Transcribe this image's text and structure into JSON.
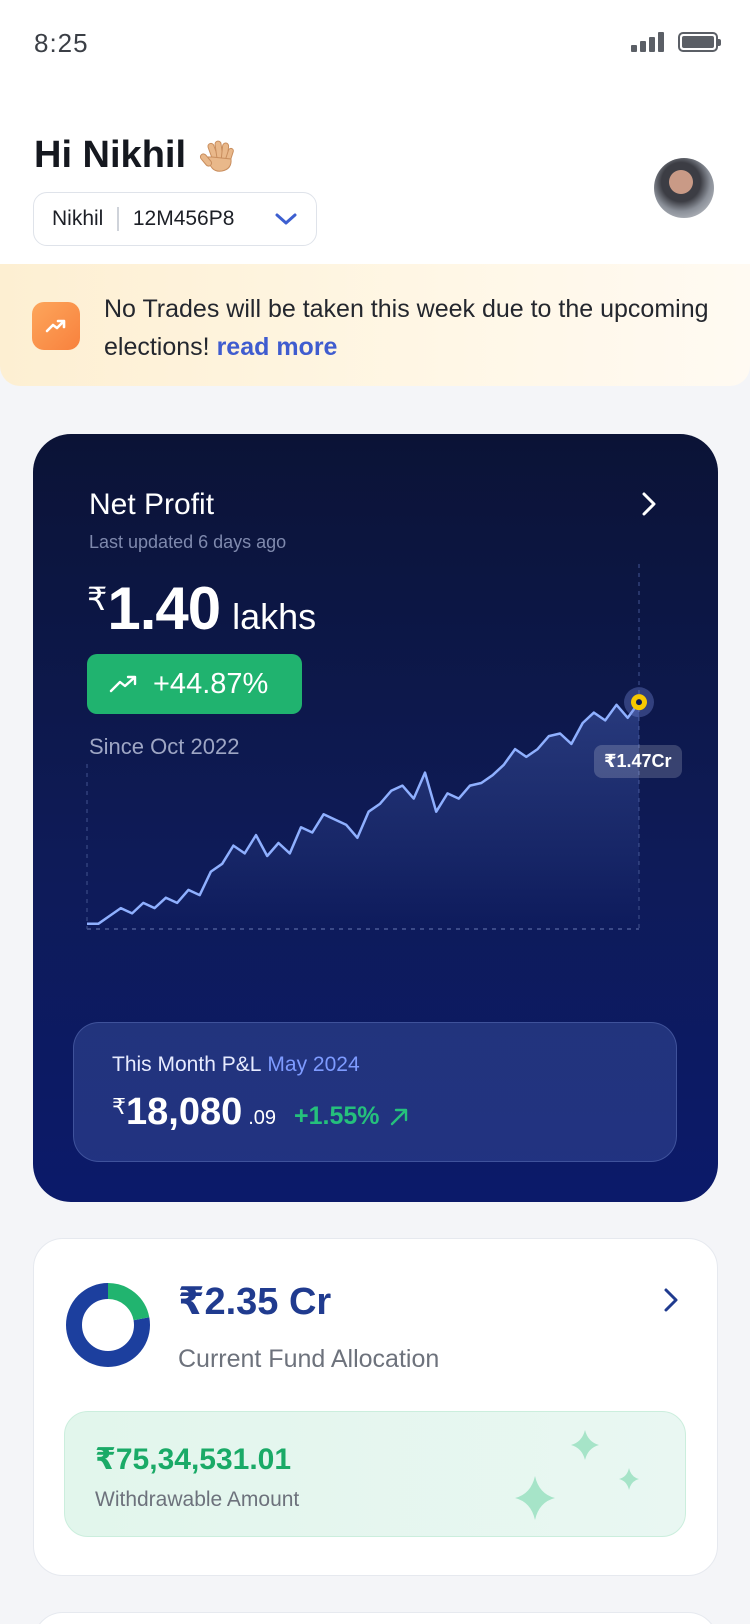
{
  "status_bar": {
    "time": "8:25"
  },
  "header": {
    "greeting": "Hi Nikhil",
    "account": {
      "name": "Nikhil",
      "id": "12M456P8"
    }
  },
  "notice": {
    "text": "No Trades will be taken this week due to the upcoming elections!",
    "link": "read more"
  },
  "net_profit": {
    "title": "Net Profit",
    "updated": "Last updated 6 days ago",
    "currency": "₹",
    "value": "1.40",
    "unit": "lakhs",
    "change": "+44.87%",
    "since": "Since Oct 2022",
    "peak_label": "₹1.47Cr",
    "colors": {
      "line": "#8fb0ff",
      "peak_dot": "#f7c800",
      "gain": "#20b36f"
    }
  },
  "chart_data": {
    "type": "line",
    "x": [
      0,
      1,
      2,
      3,
      4,
      5,
      6,
      7,
      8,
      9,
      10,
      11,
      12,
      13,
      14,
      15,
      16,
      17,
      18,
      19,
      20,
      21,
      22,
      23,
      24,
      25,
      26,
      27,
      28,
      29,
      30,
      31,
      32,
      33,
      34,
      35,
      36,
      37,
      38,
      39,
      40,
      41,
      42,
      43,
      44,
      45,
      46,
      47,
      48,
      49
    ],
    "values": [
      0.2,
      0.2,
      0.5,
      0.8,
      0.6,
      1.0,
      0.8,
      1.2,
      1.0,
      1.5,
      1.3,
      2.2,
      2.5,
      3.2,
      2.9,
      3.6,
      2.8,
      3.3,
      2.9,
      3.9,
      3.7,
      4.4,
      4.2,
      4.0,
      3.5,
      4.5,
      4.8,
      5.3,
      5.5,
      5.0,
      6.0,
      4.5,
      5.2,
      5.0,
      5.5,
      5.6,
      5.9,
      6.3,
      6.9,
      6.6,
      6.9,
      7.4,
      7.5,
      7.1,
      7.9,
      8.3,
      8.0,
      8.6,
      8.1,
      8.7
    ],
    "ylim": [
      0,
      14
    ]
  },
  "month_pl": {
    "label": "This Month P&L",
    "month": "May 2024",
    "currency": "₹",
    "value": "18,080",
    "decimals": ".09",
    "change": "+1.55%"
  },
  "fund": {
    "amount": "₹2.35 Cr",
    "label": "Current Fund Allocation",
    "donut": {
      "allocated_fraction": 0.78,
      "colors": [
        "#1c3f9e",
        "#21b46f"
      ]
    },
    "withdrawable_amount": "₹75,34,531.01",
    "withdrawable_label": "Withdrawable Amount"
  }
}
